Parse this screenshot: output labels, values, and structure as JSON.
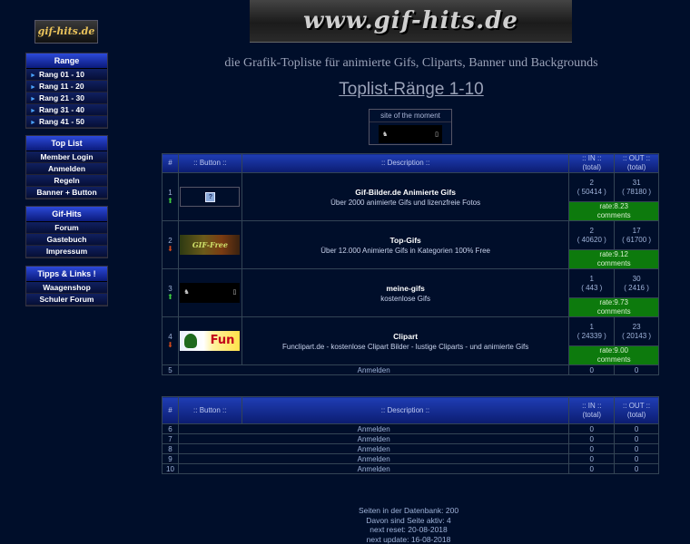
{
  "header": {
    "logo_small": "gif-hits.de",
    "logo_banner": "www.gif-hits.de",
    "tagline": "die Grafik-Topliste für animierte Gifs, Cliparts, Banner und Backgrounds",
    "page_heading": "Toplist-Ränge 1-10"
  },
  "sidebar": {
    "range": {
      "title": "Range",
      "items": [
        "Rang 01 - 10",
        "Rang 11 - 20",
        "Rang 21 - 30",
        "Rang 31 - 40",
        "Rang 41 - 50"
      ]
    },
    "toplist": {
      "title": "Top List",
      "items": [
        "Member Login",
        "Anmelden",
        "Regeln",
        "Banner + Button"
      ]
    },
    "gifhits": {
      "title": "Gif-Hits",
      "items": [
        "Forum",
        "Gastebuch",
        "Impressum"
      ]
    },
    "tipps": {
      "title": "Tipps & Links !",
      "items": [
        "Waagenshop",
        "Schuler Forum"
      ]
    }
  },
  "sotm": {
    "label": "site of the moment"
  },
  "table_headers": {
    "rank": "#",
    "button": ":: Button ::",
    "description": ":: Description ::",
    "in": ":: IN ::",
    "in_sub": "(total)",
    "out": ":: OUT ::",
    "out_sub": "(total)"
  },
  "entries": [
    {
      "rank": "1",
      "trend": "up",
      "name": "Gif-Bilder.de Animierte Gifs",
      "desc": "Über 2000 animierte Gifs und lizenzfreie Fotos",
      "in": "2",
      "in_total": "( 50414 )",
      "out": "31",
      "out_total": "( 78180 )",
      "rate": "rate:8.23",
      "comments": "comments"
    },
    {
      "rank": "2",
      "trend": "down",
      "name": "Top-Gifs",
      "desc": "Über 12.000 Animierte Gifs in Kategorien 100% Free",
      "in": "2",
      "in_total": "( 40620 )",
      "out": "17",
      "out_total": "( 61700 )",
      "rate": "rate:9.12",
      "comments": "comments"
    },
    {
      "rank": "3",
      "trend": "up",
      "name": "meine-gifs",
      "desc": "kostenlose Gifs",
      "in": "1",
      "in_total": "( 443 )",
      "out": "30",
      "out_total": "( 2416 )",
      "rate": "rate:9.73",
      "comments": "comments"
    },
    {
      "rank": "4",
      "trend": "down",
      "name": "Clipart",
      "desc": "Funclipart.de - kostenlose Clipart Bilder - lustige Cliparts - und animierte Gifs",
      "in": "1",
      "in_total": "( 24339 )",
      "out": "23",
      "out_total": "( 20143 )",
      "rate": "rate:9.00",
      "comments": "comments"
    }
  ],
  "btn_labels": {
    "btn2": "GIF-Free",
    "btn4": "Fun"
  },
  "empty_rows_1": [
    {
      "rank": "5",
      "label": "Anmelden",
      "in": "0",
      "out": "0"
    }
  ],
  "empty_rows_2": [
    {
      "rank": "6",
      "label": "Anmelden",
      "in": "0",
      "out": "0"
    },
    {
      "rank": "7",
      "label": "Anmelden",
      "in": "0",
      "out": "0"
    },
    {
      "rank": "8",
      "label": "Anmelden",
      "in": "0",
      "out": "0"
    },
    {
      "rank": "9",
      "label": "Anmelden",
      "in": "0",
      "out": "0"
    },
    {
      "rank": "10",
      "label": "Anmelden",
      "in": "0",
      "out": "0"
    }
  ],
  "footer": {
    "line1": "Seiten in der Datenbank: 200",
    "line2": "Davon sind Seite aktiv: 4",
    "line3": "next reset: 20-08-2018",
    "line4": "next update: 16-08-2018"
  }
}
